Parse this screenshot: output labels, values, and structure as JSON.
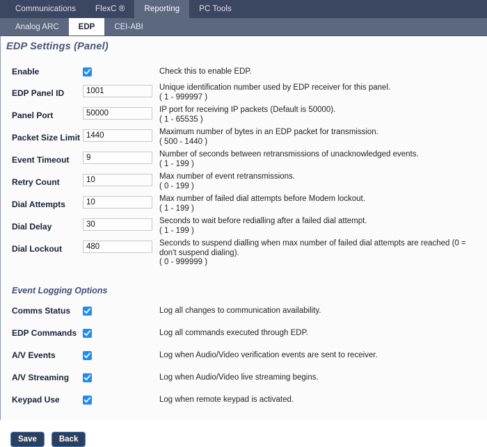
{
  "primary_tabs": [
    {
      "label": "Communications",
      "active": false
    },
    {
      "label": "FlexC ®",
      "active": false
    },
    {
      "label": "Reporting",
      "active": true
    },
    {
      "label": "PC Tools",
      "active": false
    }
  ],
  "secondary_tabs": [
    {
      "label": "Analog ARC",
      "active": false
    },
    {
      "label": "EDP",
      "active": true
    },
    {
      "label": "CEI-ABI",
      "active": false
    }
  ],
  "page": {
    "title": "EDP Settings (Panel)"
  },
  "settings": {
    "enable": {
      "label": "Enable",
      "checked": true,
      "description": "Check this to enable EDP.",
      "range": ""
    },
    "fields": [
      {
        "label": "EDP Panel ID",
        "value": "1001",
        "description": "Unique identification number used by EDP receiver for this panel.",
        "range": "( 1 - 999997 )"
      },
      {
        "label": "Panel Port",
        "value": "50000",
        "description": "IP port for receiving IP packets (Default is 50000).",
        "range": "( 1 - 65535 )"
      },
      {
        "label": "Packet Size Limit",
        "value": "1440",
        "description": "Maximum number of bytes in an EDP packet for transmission.",
        "range": "( 500 - 1440 )"
      },
      {
        "label": "Event Timeout",
        "value": "9",
        "description": "Number of seconds between retransmissions of unacknowledged events.",
        "range": "( 1 - 199 )"
      },
      {
        "label": "Retry Count",
        "value": "10",
        "description": "Max number of event retransmissions.",
        "range": "( 0 - 199 )"
      },
      {
        "label": "Dial Attempts",
        "value": "10",
        "description": "Max number of failed dial attempts before Modem lockout.",
        "range": "( 1 - 199 )"
      },
      {
        "label": "Dial Delay",
        "value": "30",
        "description": "Seconds to wait before redialling after a failed dial attempt.",
        "range": "( 1 - 199 )"
      },
      {
        "label": "Dial Lockout",
        "value": "480",
        "description": "Seconds to suspend dialling when max number of failed dial attempts are reached (0 = don't suspend dialing).",
        "range": "( 0 - 999999 )"
      }
    ]
  },
  "event_logging": {
    "heading": "Event Logging Options",
    "options": [
      {
        "label": "Comms Status",
        "checked": true,
        "description": "Log all changes to communication availability."
      },
      {
        "label": "EDP Commands",
        "checked": true,
        "description": "Log all commands executed through EDP."
      },
      {
        "label": "A/V Events",
        "checked": true,
        "description": "Log when Audio/Video verification events are sent to receiver."
      },
      {
        "label": "A/V Streaming",
        "checked": true,
        "description": "Log when Audio/Video live streaming begins."
      },
      {
        "label": "Keypad Use",
        "checked": true,
        "description": "Log when remote keypad is activated."
      }
    ]
  },
  "actions": {
    "save_label": "Save",
    "back_label": "Back"
  },
  "colors": {
    "topbar": "#3b4661",
    "subbar": "#5c6880",
    "active_tab": "#ffffff",
    "title": "#4a5578",
    "section_heading": "#3f4f7a",
    "checkbox": "#1f8cf0",
    "button_bg": "#2e3f5c",
    "button_border": "#3f7fc4"
  }
}
